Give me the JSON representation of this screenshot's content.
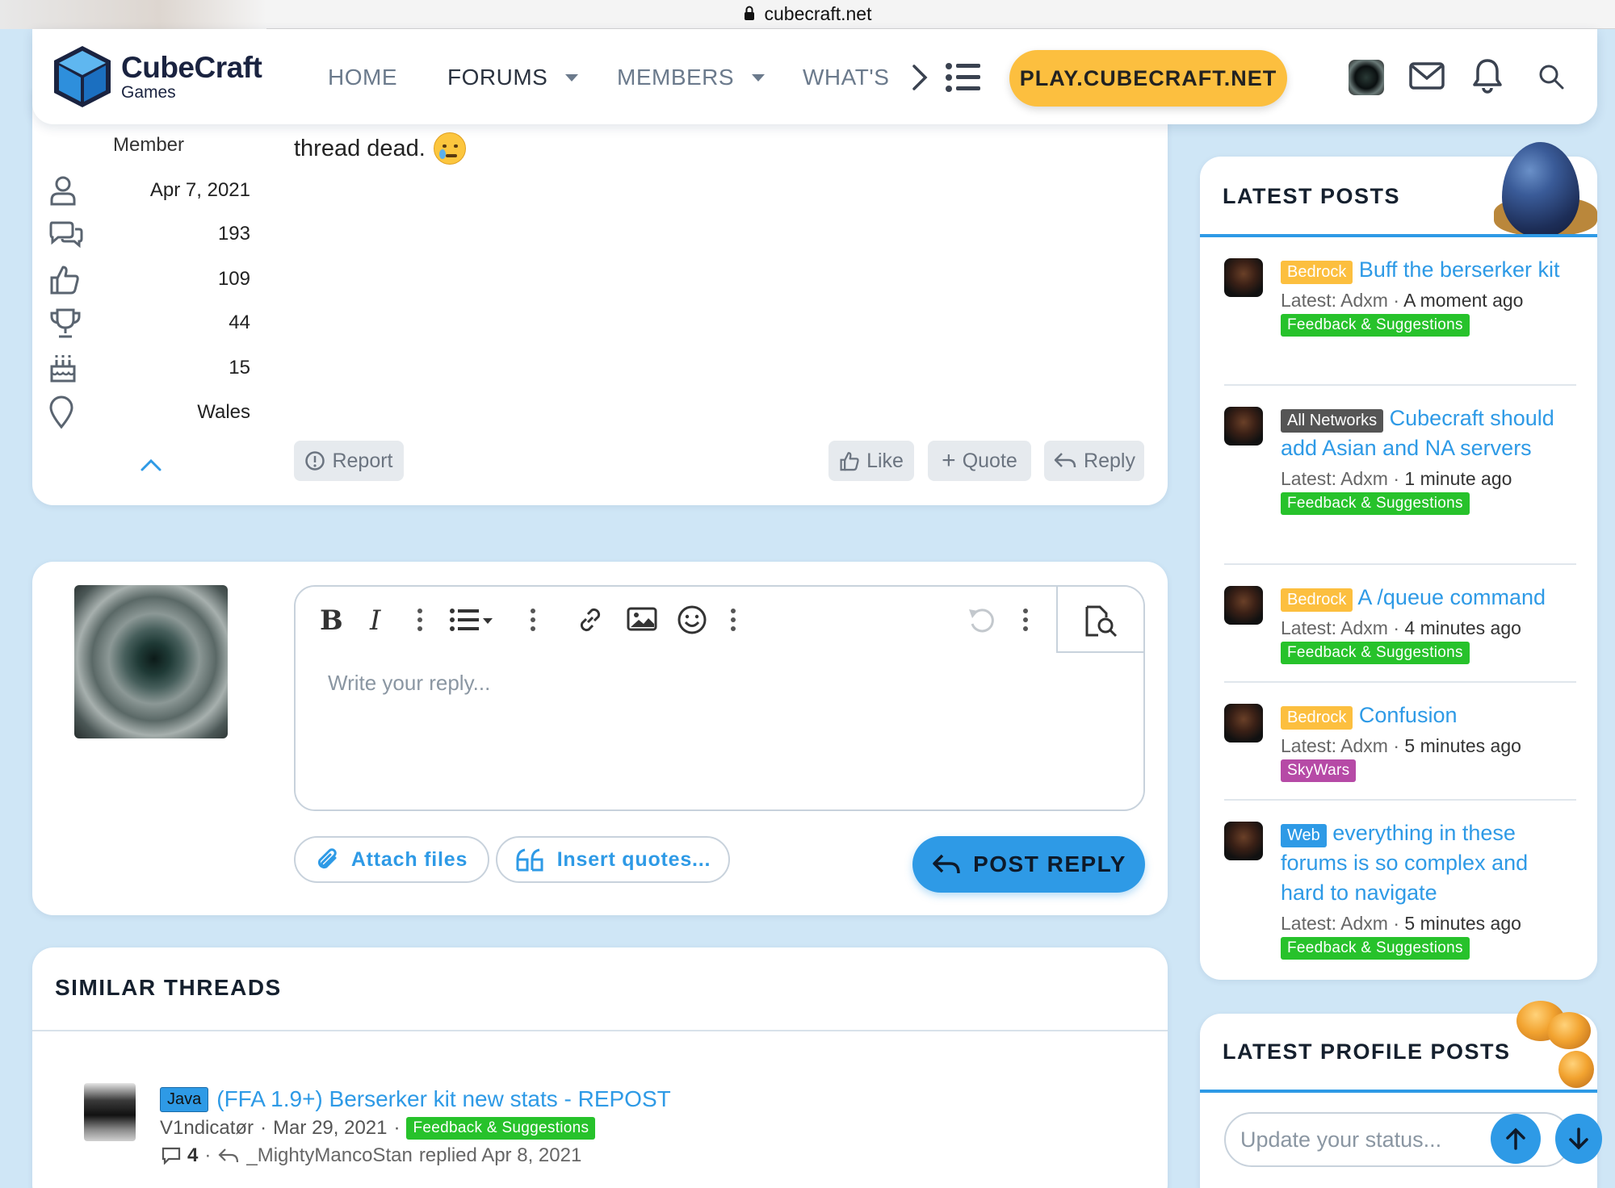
{
  "browser": {
    "url": "cubecraft.net"
  },
  "header": {
    "logo_name": "CubeCraft",
    "logo_sub": "Games",
    "nav": [
      {
        "label": "HOME"
      },
      {
        "label": "FORUMS"
      },
      {
        "label": "MEMBERS"
      },
      {
        "label": "WHAT'S"
      }
    ],
    "play_label": "PLAY.CUBECRAFT.NET"
  },
  "post": {
    "user_title": "Member",
    "stats": {
      "joined": "Apr 7, 2021",
      "messages": "193",
      "reactions": "109",
      "points": "44",
      "age": "15",
      "location": "Wales"
    },
    "text": "thread dead.",
    "actions": {
      "report": "Report",
      "like": "Like",
      "quote": "Quote",
      "reply": "Reply"
    }
  },
  "reply_form": {
    "placeholder": "Write your reply...",
    "attach": "Attach files",
    "insert_quotes": "Insert quotes...",
    "post_reply": "POST REPLY"
  },
  "similar": {
    "title": "SIMILAR THREADS",
    "threads": [
      {
        "prefix": "Java",
        "title": "(FFA 1.9+) Berserker kit new stats - REPOST",
        "author": "V1ndicatør",
        "date": "Mar 29, 2021",
        "forum": "Feedback & Suggestions",
        "replies": "4",
        "last_user": "_MightyMancoStan",
        "replied": "replied Apr 8, 2021"
      }
    ]
  },
  "latest_posts": {
    "title": "LATEST POSTS",
    "items": [
      {
        "prefix": "Bedrock",
        "title": "Buff the berserker kit",
        "latest_label": "Latest: Adxm",
        "time": "A moment ago",
        "forum": "Feedback & Suggestions"
      },
      {
        "prefix": "All Networks",
        "title": "Cubecraft should add Asian and NA servers",
        "latest_label": "Latest: Adxm",
        "time": "1 minute ago",
        "forum": "Feedback & Suggestions"
      },
      {
        "prefix": "Bedrock",
        "title": "A /queue command",
        "latest_label": "Latest: Adxm",
        "time": "4 minutes ago",
        "forum": "Feedback & Suggestions"
      },
      {
        "prefix": "Bedrock",
        "title": "Confusion",
        "latest_label": "Latest: Adxm",
        "time": "5 minutes ago",
        "forum": "SkyWars"
      },
      {
        "prefix": "Web",
        "title": "everything in these forums is so complex and hard to navigate",
        "latest_label": "Latest: Adxm",
        "time": "5 minutes ago",
        "forum": "Feedback & Suggestions"
      }
    ]
  },
  "profile_posts": {
    "title": "LATEST PROFILE POSTS",
    "placeholder": "Update your status..."
  },
  "colors": {
    "accent": "#2e9ae6",
    "play": "#fcbf3f",
    "bedrock": "#fcbf3f",
    "feedback": "#27c22b",
    "skywars": "#b64aa6",
    "background": "#cfe6f6"
  }
}
